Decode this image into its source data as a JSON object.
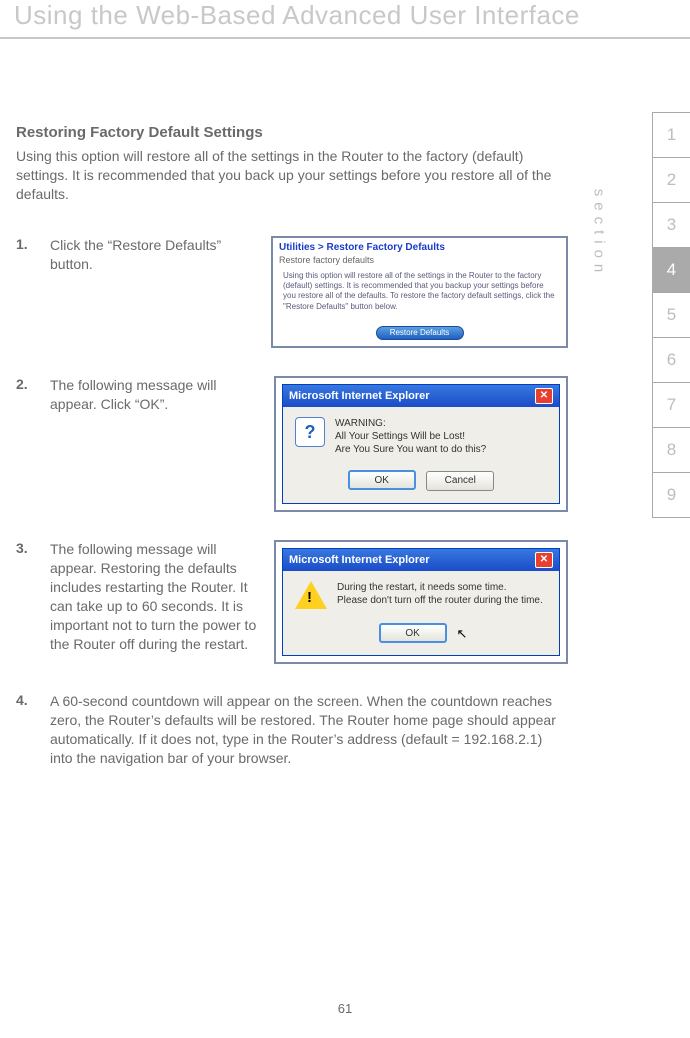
{
  "chapter_title": "Using the Web-Based Advanced User Interface",
  "heading": "Restoring Factory Default Settings",
  "intro": "Using this option will restore all of the settings in the Router to the factory (default) settings. It is recommended that you back up your settings before you restore all of the defaults.",
  "steps": {
    "s1": {
      "num": "1.",
      "text": "Click the “Restore Defaults” button."
    },
    "s2": {
      "num": "2.",
      "text": "The following message will appear. Click “OK”."
    },
    "s3": {
      "num": "3.",
      "text": "The following message will appear. Restoring the defaults includes restarting the Router. It can take up to 60 seconds. It is important not to turn the power to the Router off during the restart."
    },
    "s4": {
      "num": "4.",
      "text": "A 60-second countdown will appear on the screen. When the countdown reaches zero, the Router’s defaults will be restored. The Router home page should appear automatically. If it does not, type in the Router’s address (default = 192.168.2.1) into the navigation bar of your browser."
    }
  },
  "panel1": {
    "title": "Utilities > Restore Factory Defaults",
    "subtitle": "Restore factory defaults",
    "body": "Using this option will restore all of the settings in the Router to the factory (default) settings. It is recommended that you backup your settings before you restore all of the defaults. To restore the factory default settings, click the \"Restore Defaults\" button below.",
    "button": "Restore Defaults"
  },
  "dialog1": {
    "title": "Microsoft Internet Explorer",
    "line1": "WARNING:",
    "line2": "All Your Settings Will be Lost!",
    "line3": "Are You Sure You want to do this?",
    "ok": "OK",
    "cancel": "Cancel"
  },
  "dialog2": {
    "title": "Microsoft Internet Explorer",
    "line1": "During the restart, it needs some time.",
    "line2": "Please don't turn off the router during the time.",
    "ok": "OK"
  },
  "tabs": [
    "1",
    "2",
    "3",
    "4",
    "5",
    "6",
    "7",
    "8",
    "9"
  ],
  "active_tab_index": 3,
  "section_label": "section",
  "page_number": "61"
}
